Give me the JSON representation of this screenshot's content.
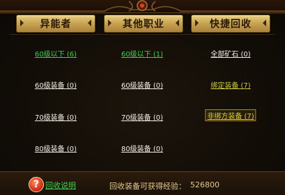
{
  "headers": {
    "col1": "异能者",
    "col2": "其他职业",
    "col3": "快捷回收"
  },
  "col1": [
    "60级以下 (6)",
    "60级装备 (0)",
    "70级装备 (0)",
    "80级装备 (0)"
  ],
  "col2": [
    "60级以下 (1)",
    "60级装备 (0)",
    "70级装备 (0)",
    "80级装备 (0)"
  ],
  "col3": [
    "全部矿石 (0)",
    "绑定装备 (7)",
    "非绑方装备 (7)"
  ],
  "footer": {
    "help": "回收说明",
    "exp_label": "回收装备可获得经验：",
    "exp_value": "526800"
  },
  "icons": {
    "help": "question-mark-icon"
  },
  "colors": {
    "green_link": "#3fd14a",
    "yellow_link": "#d6d23a",
    "white_link": "#f2efe6",
    "header_gold": "#c9a655"
  }
}
